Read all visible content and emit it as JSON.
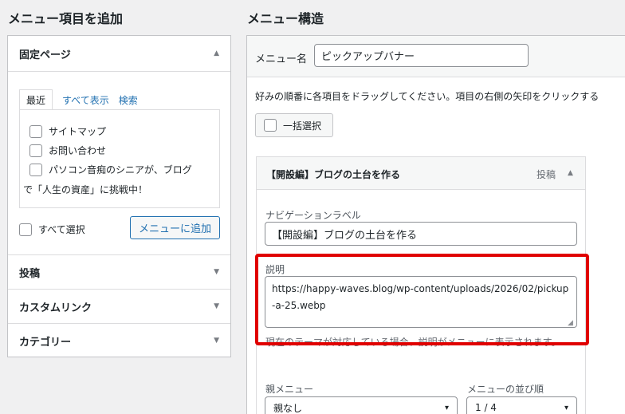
{
  "left": {
    "heading": "メニュー項目を追加",
    "fixed_pages": {
      "title": "固定ページ",
      "tabs": [
        "最近",
        "すべて表示",
        "検索"
      ],
      "items": [
        "サイトマップ",
        "お問い合わせ",
        "パソコン音痴のシニアが、ブログ"
      ],
      "item_continuation": "で「人生の資産」に挑戦中！",
      "select_all_label": "すべて選択",
      "add_button": "メニューに追加"
    },
    "sections": [
      "投稿",
      "カスタムリンク",
      "カテゴリー"
    ]
  },
  "right": {
    "heading": "メニュー構造",
    "menu_name_label": "メニュー名",
    "menu_name_value": "ピックアップバナー",
    "instructions": "好みの順番に各項目をドラッグしてください。項目の右側の矢印をクリックする",
    "bulk_select": "一括選択",
    "item": {
      "title": "【開設編】ブログの土台を作る",
      "type": "投稿",
      "nav_label_caption": "ナビゲーションラベル",
      "nav_label_value": "【開設編】ブログの土台を作る",
      "description_caption": "説明",
      "description_value": "https://happy-waves.blog/wp-content/uploads/2026/02/pickup-a-25.webp",
      "description_help": "現在のテーマが対応している場合、説明がメニューに表示されます。",
      "parent_caption": "親メニュー",
      "parent_value": "親なし",
      "order_caption": "メニューの並び順",
      "order_value": "1 / 4"
    }
  },
  "colors": {
    "highlight": "#e00000",
    "link": "#2271b1"
  }
}
